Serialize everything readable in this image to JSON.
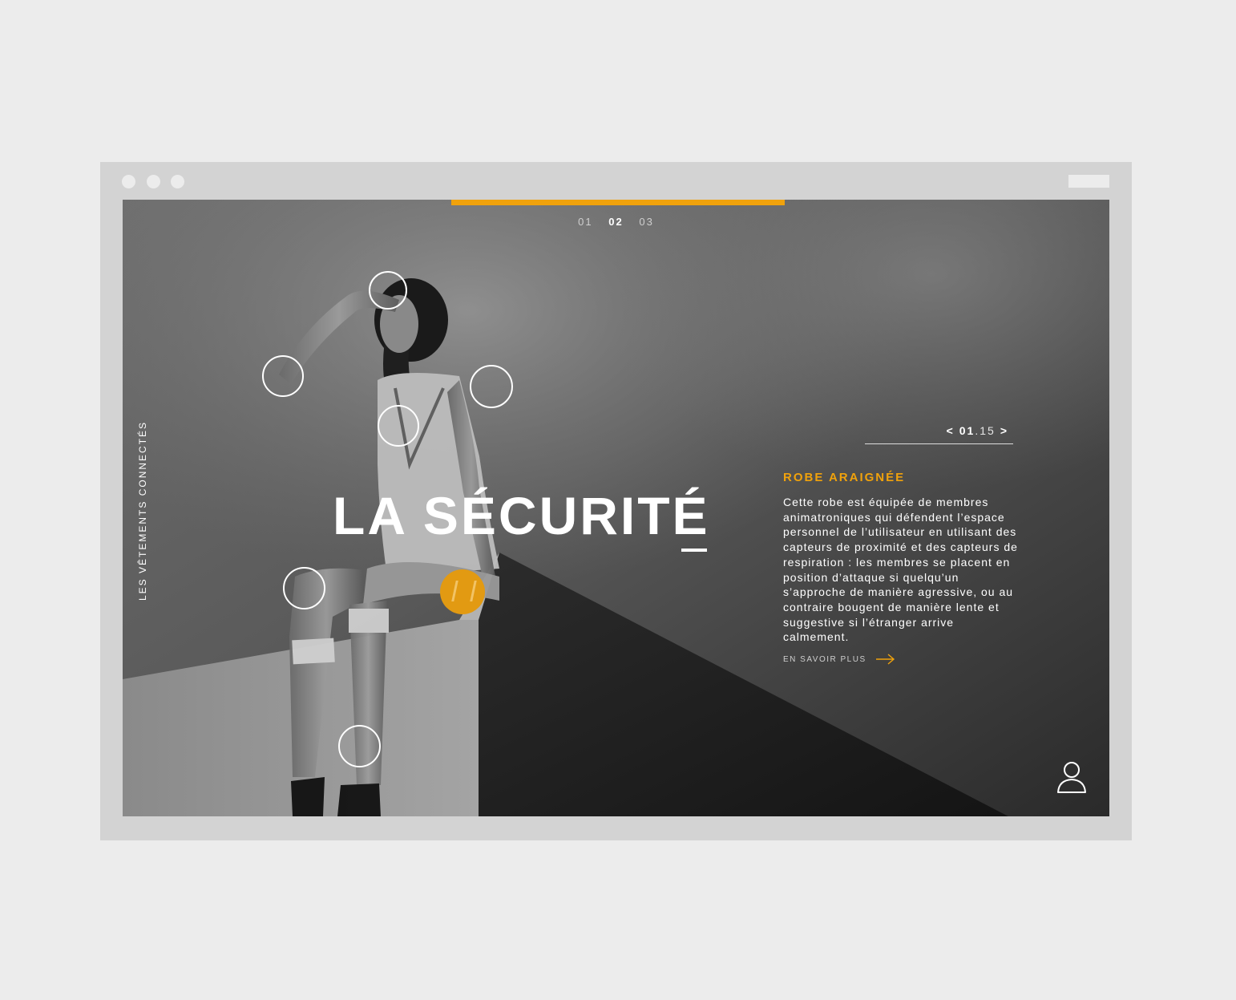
{
  "slider": {
    "pages": [
      "01",
      "02",
      "03"
    ],
    "active_page": "02"
  },
  "sidebar": {
    "vertical_label": "LES VÊTEMENTS CONNECTÉS"
  },
  "hero": {
    "title": "LA SÉCURITÉ"
  },
  "product_nav": {
    "prev": "<",
    "current": "01",
    "separator_total": ".15",
    "next": ">"
  },
  "product": {
    "title": "ROBE ARAIGNÉE",
    "description": "Cette robe est équipée de membres animatroniques qui défendent l’espace personnel de l’utilisateur en utilisant des capteurs de proximité et des capteurs de respiration : les membres se placent en position d’attaque si quelqu’un s’approche de manière agressive, ou au contraire bougent de manière lente et suggestive si l’étranger arrive calmement.",
    "link_label": "EN SAVOIR PLUS",
    "link_icon": "arrow-right-icon"
  },
  "icons": {
    "account": "user-icon"
  },
  "colors": {
    "accent": "#f0a20c",
    "page_bg": "#ececec",
    "browser_frame": "#d3d3d3"
  }
}
